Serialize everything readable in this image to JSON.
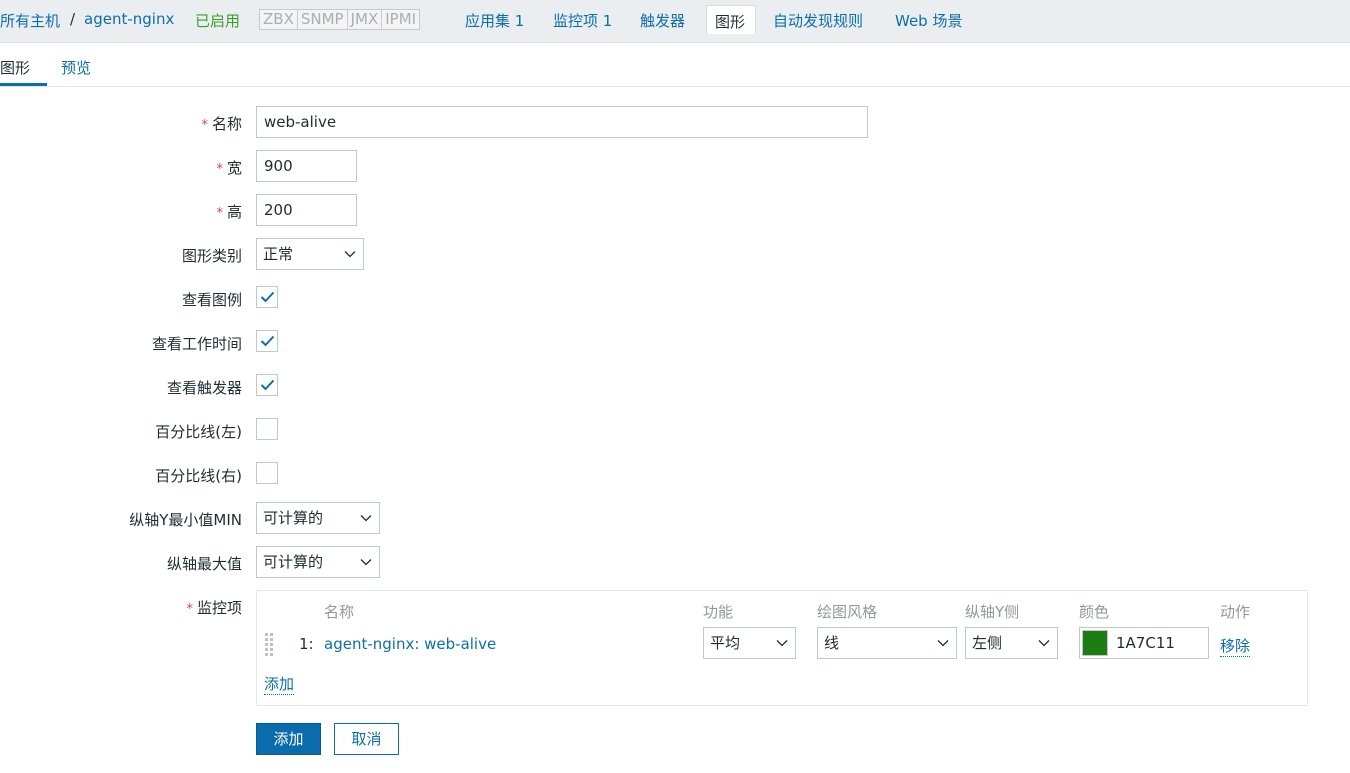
{
  "nav": {
    "all_hosts": "所有主机",
    "separator": "/",
    "host": "agent-nginx",
    "status": "已启用",
    "badges": [
      "ZBX",
      "SNMP",
      "JMX",
      "IPMI"
    ],
    "applications": "应用集 1",
    "items": "监控项 1",
    "triggers": "触发器",
    "graphs": "图形",
    "discovery": "自动发现规则",
    "web": "Web 场景"
  },
  "subtabs": {
    "graph": "图形",
    "preview": "预览"
  },
  "form": {
    "name_label": "名称",
    "name_value": "web-alive",
    "width_label": "宽",
    "width_value": "900",
    "height_label": "高",
    "height_value": "200",
    "graph_type_label": "图形类别",
    "graph_type_value": "正常",
    "show_legend_label": "查看图例",
    "show_legend": true,
    "show_working_time_label": "查看工作时间",
    "show_working_time": true,
    "show_triggers_label": "查看触发器",
    "show_triggers": true,
    "percentile_left_label": "百分比线(左)",
    "percentile_left": false,
    "percentile_right_label": "百分比线(右)",
    "percentile_right": false,
    "ymin_label": "纵轴Y最小值MIN",
    "ymin_value": "可计算的",
    "ymax_label": "纵轴最大值",
    "ymax_value": "可计算的",
    "items_label": "监控项",
    "required_mark": "*"
  },
  "items_table": {
    "headers": {
      "name": "名称",
      "function": "功能",
      "draw_style": "绘图风格",
      "y_side": "纵轴Y侧",
      "color": "颜色",
      "action": "动作"
    },
    "rows": [
      {
        "index": "1:",
        "name": "agent-nginx: web-alive",
        "function": "平均",
        "draw_style": "线",
        "y_side": "左侧",
        "color_hex": "1A7C11",
        "color": "#1A7C11",
        "action": "移除"
      }
    ],
    "add_link": "添加"
  },
  "buttons": {
    "add": "添加",
    "cancel": "取消"
  },
  "colors": {
    "accent": "#0c6fa7",
    "enabled": "#3a9f2a",
    "required": "#d04848"
  }
}
